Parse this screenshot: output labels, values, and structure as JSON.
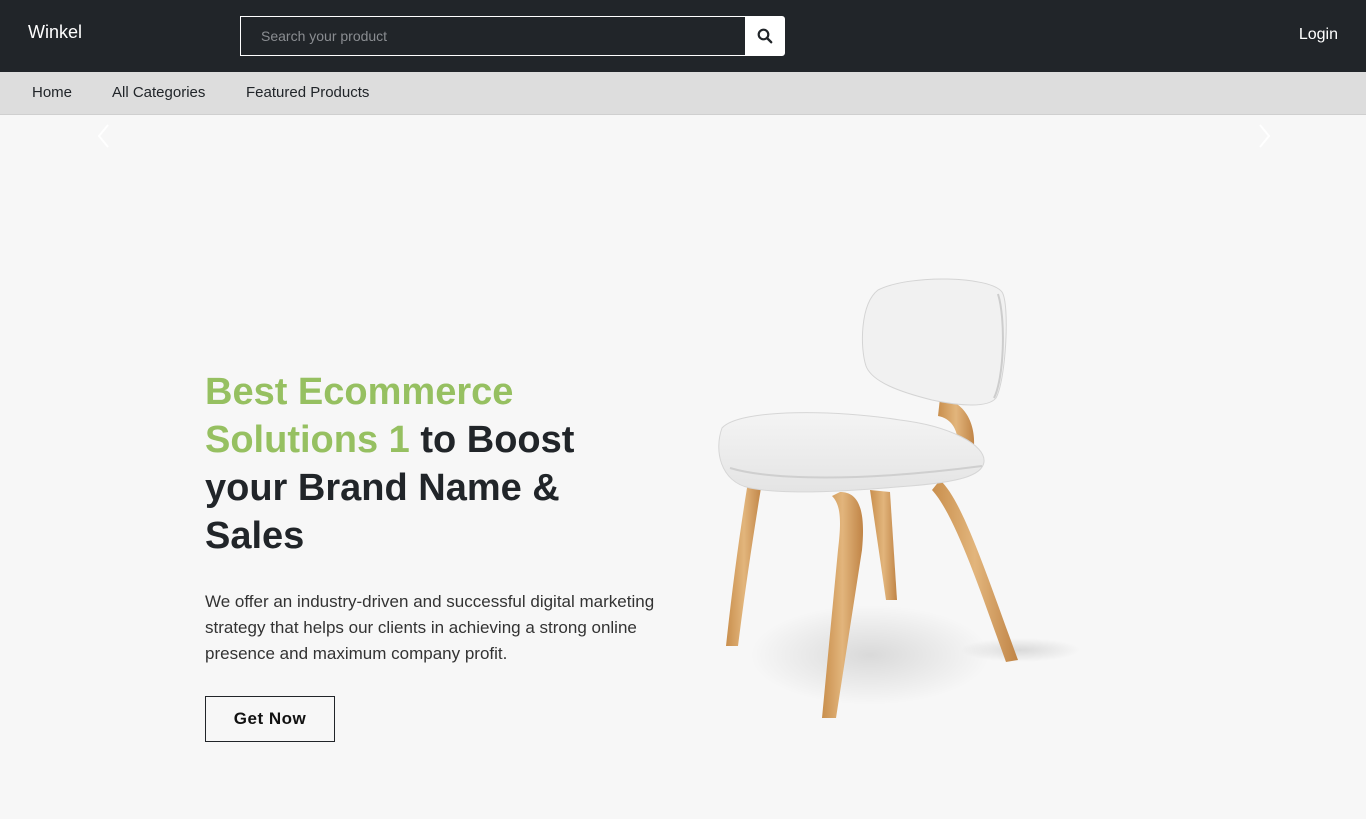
{
  "header": {
    "brand": "Winkel",
    "search_placeholder": "Search your product",
    "login_label": "Login"
  },
  "nav": {
    "items": [
      {
        "label": "Home"
      },
      {
        "label": "All Categories"
      },
      {
        "label": "Featured Products"
      }
    ]
  },
  "hero": {
    "title_accent": "Best Ecommerce Solutions 1",
    "title_rest": " to Boost your Brand Name & Sales",
    "description": "We offer an industry-driven and successful digital marketing strategy that helps our clients in achieving a strong online presence and maximum company profit.",
    "cta_label": "Get Now"
  },
  "colors": {
    "header_bg": "#212529",
    "nav_bg": "#dddddd",
    "accent": "#96c061",
    "page_bg": "#f7f7f7"
  },
  "icons": [
    "search-icon",
    "carousel-prev-icon",
    "carousel-next-icon"
  ]
}
